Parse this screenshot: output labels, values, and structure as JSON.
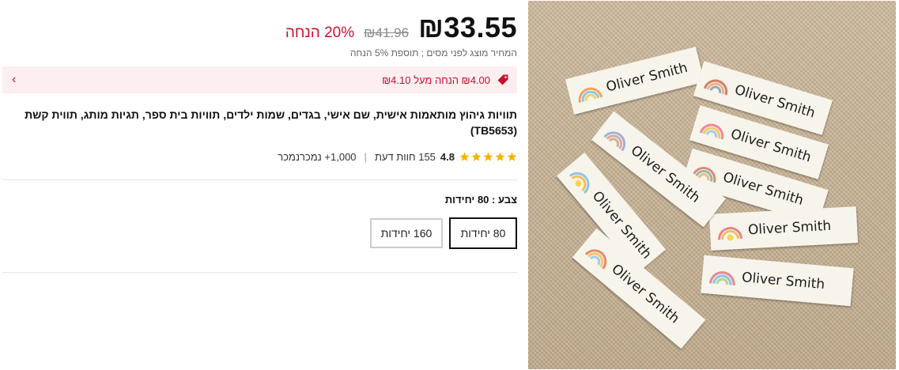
{
  "price": {
    "current": "₪33.55",
    "original": "₪41.96",
    "discount": "20% הנחה",
    "tax_note": "המחיר מוצג לפני מסים ; תוספת 5% הנחה"
  },
  "promo": {
    "text": "₪4.00 הנחה מעל ₪4.10",
    "accent_color": "#c8102e",
    "icon": "price-tag-icon"
  },
  "product": {
    "title": "תוויות גיהוץ מותאמות אישית, שם אישי, בגדים, שמות ילדים, תוויות בית ספר, תגיות מותג, תווית קשת (TB5653)"
  },
  "rating": {
    "score": "4.8",
    "reviews": "155 חוות דעת",
    "sold": "1,000+ נמכרנמכר",
    "star_color": "#f5b301",
    "stars": 5
  },
  "variant": {
    "label": "צבע : 80 יחידות",
    "options": [
      "80 יחידות",
      "160 יחידות"
    ],
    "selected": "80 יחידות"
  },
  "image": {
    "label_text": "Oliver Smith"
  }
}
